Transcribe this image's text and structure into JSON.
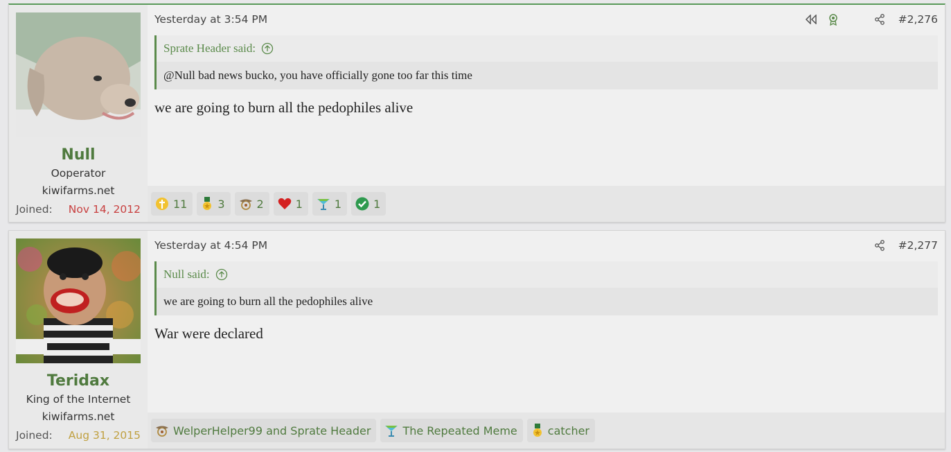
{
  "posts": [
    {
      "author": "Null",
      "user_title": "Ooperator",
      "site": "kiwifarms.net",
      "joined_label": "Joined:",
      "joined_date": "Nov 14, 2012",
      "timestamp": "Yesterday at 3:54 PM",
      "post_number": "#2,276",
      "quote_author": "Sprate Header said:",
      "quote_text": "@Null bad news bucko, you have officially gone too far this time",
      "message": "we are going to burn all the pedophiles alive",
      "reactions": [
        {
          "icon": "gold-cross-icon",
          "count": "11"
        },
        {
          "icon": "medal-icon",
          "count": "3"
        },
        {
          "icon": "eagle-emblem-icon",
          "count": "2"
        },
        {
          "icon": "heart-icon",
          "count": "1"
        },
        {
          "icon": "cocktail-icon",
          "count": "1"
        },
        {
          "icon": "checkmark-icon",
          "count": "1"
        }
      ]
    },
    {
      "author": "Teridax",
      "user_title": "King of the Internet",
      "site": "kiwifarms.net",
      "joined_label": "Joined:",
      "joined_date": "Aug 31, 2015",
      "timestamp": "Yesterday at 4:54 PM",
      "post_number": "#2,277",
      "quote_author": "Null said:",
      "quote_text": "we are going to burn all the pedophiles alive",
      "message": "War were declared",
      "reactions": [
        {
          "icon": "eagle-emblem-icon",
          "label": "WelperHelper99 and Sprate Header"
        },
        {
          "icon": "cocktail-icon",
          "label": "The Repeated Meme"
        },
        {
          "icon": "medal-icon",
          "label": "catcher"
        }
      ]
    }
  ],
  "colors": {
    "username": "#4f7a3e",
    "accent": "#5a8a4a",
    "joined_red": "#c84040",
    "joined_gold": "#c0a040"
  }
}
